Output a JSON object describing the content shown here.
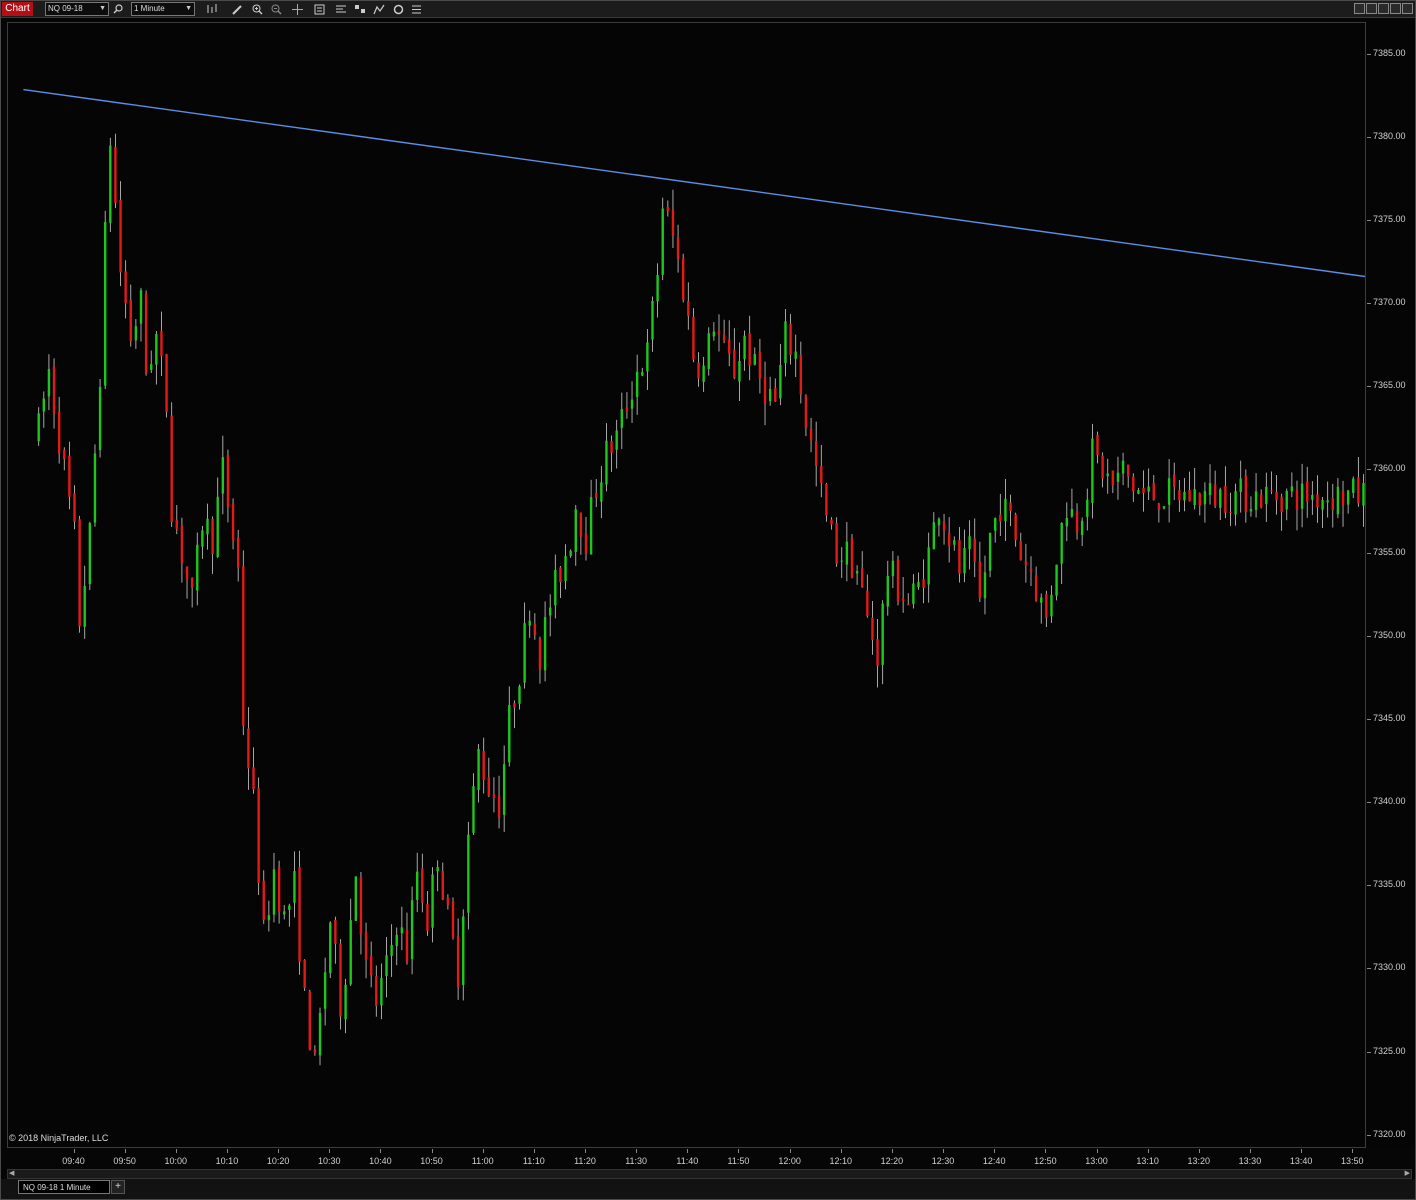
{
  "toolbar": {
    "window_label": "Chart",
    "instrument": "NQ 09-18",
    "interval": "1 Minute",
    "icons": [
      "search-icon",
      "bar-type-icon",
      "pencil-icon",
      "zoom-in-icon",
      "zoom-out-icon",
      "crosshair-icon",
      "data-box-icon",
      "chart-trader-icon",
      "indicators-icon",
      "strategies-icon",
      "drawing-tools-icon",
      "properties-icon"
    ],
    "window_buttons": [
      "minimize",
      "restore",
      "maximize",
      "close"
    ]
  },
  "chart_data": {
    "type": "candlestick",
    "instrument": "NQ 09-18",
    "interval": "1 Minute",
    "y_ticks": [
      "7385.00",
      "7380.00",
      "7375.00",
      "7370.00",
      "7365.00",
      "7360.00",
      "7355.00",
      "7350.00",
      "7345.00",
      "7340.00",
      "7335.00",
      "7330.00",
      "7325.00",
      "7320.00"
    ],
    "x_ticks": [
      "09:40",
      "09:50",
      "10:00",
      "10:10",
      "10:20",
      "10:30",
      "10:40",
      "10:50",
      "11:00",
      "11:10",
      "11:20",
      "11:30",
      "11:40",
      "11:50",
      "12:00",
      "12:10",
      "12:20",
      "12:30",
      "12:40",
      "12:50",
      "13:00",
      "13:10",
      "13:20",
      "13:30",
      "13:40",
      "13:50"
    ],
    "ylim": [
      7319.2,
      7386.9
    ],
    "first_bar_time": "09:33",
    "last_bar_time": "13:53",
    "price_path": [
      [
        0,
        7362.5
      ],
      [
        2,
        7366
      ],
      [
        7,
        7356
      ],
      [
        8,
        7351
      ],
      [
        10,
        7356
      ],
      [
        12,
        7366
      ],
      [
        13,
        7374
      ],
      [
        14,
        7380
      ],
      [
        15,
        7376
      ],
      [
        16,
        7372
      ],
      [
        18,
        7368
      ],
      [
        20,
        7370
      ],
      [
        21,
        7366
      ],
      [
        23,
        7368
      ],
      [
        25,
        7364
      ],
      [
        26,
        7358
      ],
      [
        28,
        7355
      ],
      [
        30,
        7352
      ],
      [
        32,
        7357
      ],
      [
        34,
        7356
      ],
      [
        36,
        7360
      ],
      [
        37,
        7358
      ],
      [
        39,
        7354
      ],
      [
        40,
        7345
      ],
      [
        42,
        7340
      ],
      [
        44,
        7332
      ],
      [
        46,
        7336
      ],
      [
        48,
        7333
      ],
      [
        50,
        7335
      ],
      [
        52,
        7328
      ],
      [
        54,
        7324
      ],
      [
        55,
        7327
      ],
      [
        57,
        7333
      ],
      [
        59,
        7328
      ],
      [
        60,
        7330
      ],
      [
        62,
        7336
      ],
      [
        64,
        7330
      ],
      [
        66,
        7328
      ],
      [
        68,
        7330
      ],
      [
        70,
        7333
      ],
      [
        72,
        7331
      ],
      [
        74,
        7336
      ],
      [
        76,
        7333
      ],
      [
        78,
        7337
      ],
      [
        80,
        7333
      ],
      [
        82,
        7330
      ],
      [
        84,
        7338
      ],
      [
        86,
        7343
      ],
      [
        88,
        7341
      ],
      [
        90,
        7340
      ],
      [
        92,
        7345
      ],
      [
        94,
        7348
      ],
      [
        96,
        7352
      ],
      [
        98,
        7349
      ],
      [
        100,
        7352
      ],
      [
        102,
        7354
      ],
      [
        104,
        7356
      ],
      [
        105,
        7358
      ],
      [
        107,
        7356
      ],
      [
        109,
        7359
      ],
      [
        111,
        7361
      ],
      [
        113,
        7362
      ],
      [
        115,
        7364
      ],
      [
        117,
        7366
      ],
      [
        119,
        7367
      ],
      [
        121,
        7372
      ],
      [
        122,
        7376
      ],
      [
        124,
        7374
      ],
      [
        126,
        7371
      ],
      [
        128,
        7367
      ],
      [
        130,
        7366
      ],
      [
        132,
        7369
      ],
      [
        134,
        7367
      ],
      [
        136,
        7366
      ],
      [
        138,
        7368
      ],
      [
        140,
        7366
      ],
      [
        142,
        7365
      ],
      [
        144,
        7364
      ],
      [
        146,
        7368
      ],
      [
        148,
        7367
      ],
      [
        150,
        7363
      ],
      [
        152,
        7360
      ],
      [
        154,
        7357
      ],
      [
        156,
        7355
      ],
      [
        158,
        7355
      ],
      [
        160,
        7354
      ],
      [
        162,
        7351
      ],
      [
        164,
        7349
      ],
      [
        166,
        7354
      ],
      [
        168,
        7353
      ],
      [
        170,
        7352
      ],
      [
        172,
        7353
      ],
      [
        174,
        7355
      ],
      [
        176,
        7358
      ],
      [
        178,
        7356
      ],
      [
        180,
        7354
      ],
      [
        182,
        7355
      ],
      [
        184,
        7352
      ],
      [
        186,
        7356
      ],
      [
        188,
        7358
      ],
      [
        190,
        7357
      ],
      [
        192,
        7355
      ],
      [
        194,
        7354
      ],
      [
        196,
        7352
      ],
      [
        197,
        7351
      ],
      [
        199,
        7355
      ],
      [
        201,
        7358
      ],
      [
        203,
        7357
      ],
      [
        205,
        7359
      ],
      [
        206,
        7361
      ],
      [
        208,
        7360
      ],
      [
        210,
        7359
      ],
      [
        212,
        7360
      ],
      [
        214,
        7359
      ],
      [
        216,
        7358.5
      ]
    ],
    "trendline": {
      "from": {
        "time": "09:30",
        "price": 7382.9
      },
      "to": {
        "time": "13:56",
        "price": 7371.5
      }
    },
    "colors": {
      "up": "#1ec71e",
      "down": "#e31a1a",
      "wick": "#cfcfcf",
      "trendline": "#5b8ee6",
      "background": "#050505"
    }
  },
  "copyright": "© 2018 NinjaTrader, LLC",
  "tabs": [
    {
      "label": "NQ 09-18 1 Minute"
    }
  ],
  "add_tab": "+"
}
